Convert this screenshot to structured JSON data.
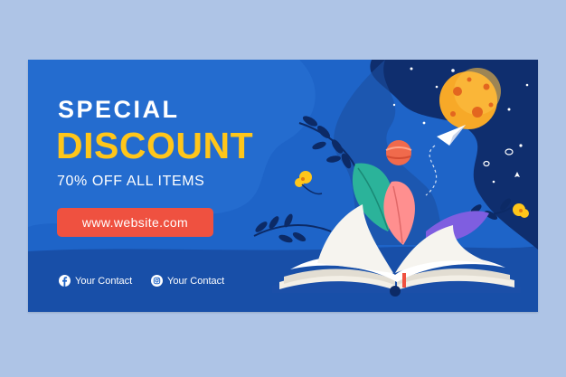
{
  "banner": {
    "title_line1": "SPECIAL",
    "title_line2": "DISCOUNT",
    "subtitle": "70% OFF ALL ITEMS",
    "website": "www.website.com",
    "contacts": [
      {
        "icon": "facebook-icon",
        "label": "Your Contact"
      },
      {
        "icon": "instagram-icon",
        "label": "Your Contact"
      }
    ]
  },
  "colors": {
    "page_background": "#aec4e6",
    "banner_blue": "#1e64c8",
    "deep_navy": "#0f2e6e",
    "discount_yellow": "#ffc61a",
    "button_red": "#ef5140",
    "moon_orange": "#f7a928"
  },
  "illustration": {
    "icons": [
      "open-book-icon",
      "moon-icon",
      "planet-icon",
      "paper-plane-icon",
      "leaf-icon",
      "flower-icon",
      "star-icon"
    ]
  }
}
